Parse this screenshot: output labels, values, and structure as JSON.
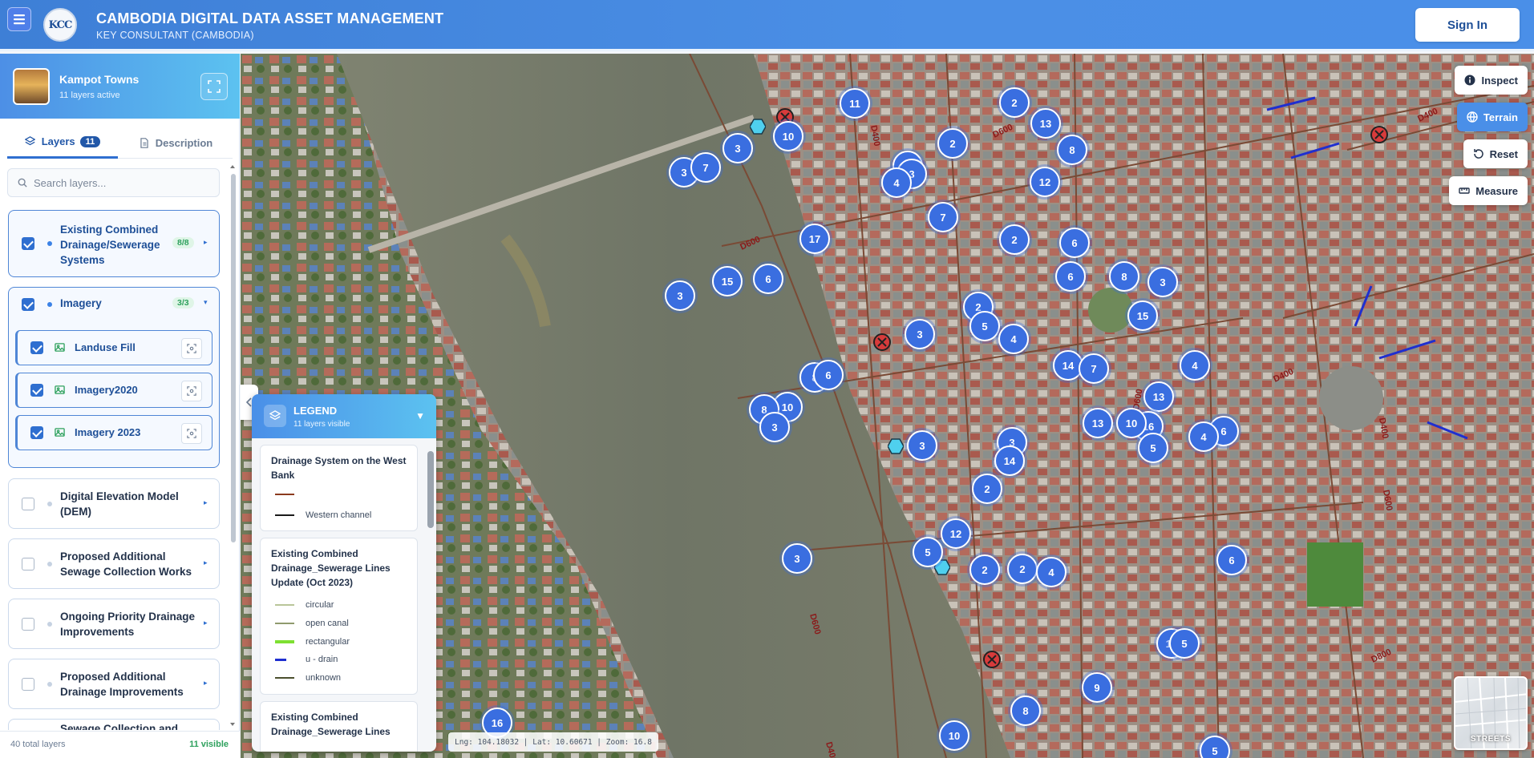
{
  "header": {
    "title": "CAMBODIA DIGITAL DATA ASSET MANAGEMENT",
    "subtitle": "KEY CONSULTANT (CAMBODIA)",
    "logo_text": "KCC",
    "sign_in_label": "Sign In"
  },
  "project": {
    "name": "Kampot Towns",
    "status": "11 layers active"
  },
  "tabs": {
    "layers_label": "Layers",
    "layers_count": "11",
    "description_label": "Description"
  },
  "search": {
    "placeholder": "Search layers..."
  },
  "layer_groups": [
    {
      "label": "Existing Combined Drainage/Sewerage Systems",
      "badge": "8/8",
      "checked": true
    },
    {
      "label": "Imagery",
      "badge": "3/3",
      "checked": true,
      "children": [
        {
          "label": "Landuse Fill",
          "checked": true
        },
        {
          "label": "Imagery2020",
          "checked": true
        },
        {
          "label": "Imagery 2023",
          "checked": true
        }
      ]
    },
    {
      "label": "Digital Elevation Model (DEM)",
      "checked": false
    },
    {
      "label": "Proposed Additional Sewage Collection Works",
      "checked": false
    },
    {
      "label": "Ongoing Priority Drainage Improvements",
      "checked": false
    },
    {
      "label": "Proposed Additional Drainage Improvements",
      "checked": false
    },
    {
      "label": "Sewage Collection and",
      "checked": false
    }
  ],
  "footer": {
    "total": "40 total layers",
    "visible": "11 visible"
  },
  "map_tools": {
    "inspect": "Inspect",
    "terrain": "Terrain",
    "reset": "Reset",
    "measure": "Measure"
  },
  "basemap_label": "STREETS",
  "coords_text": "Lng: 104.18032 | Lat: 10.60671 | Zoom: 16.8",
  "legend": {
    "title": "LEGEND",
    "subtitle": "11 layers visible",
    "sections": [
      {
        "title": "Drainage System on the West Bank",
        "items": [
          {
            "label": "",
            "color": "#8b3a1e"
          },
          {
            "label": "Western channel",
            "color": "#1a1a1a"
          }
        ]
      },
      {
        "title": "Existing Combined Drainage_Sewerage Lines Update (Oct 2023)",
        "items": [
          {
            "label": "circular",
            "color": "#b9c59a"
          },
          {
            "label": "open canal",
            "color": "#8f9a6d"
          },
          {
            "label": "rectangular",
            "color": "#7ee032"
          },
          {
            "label": "u - drain",
            "color": "#1f2fd0"
          },
          {
            "label": "unknown",
            "color": "#4b4f2e"
          }
        ]
      },
      {
        "title": "Existing Combined Drainage_Sewerage Lines"
      }
    ]
  },
  "map_labels": [
    "D600",
    "D400",
    "D600",
    "D400",
    "D600",
    "D400",
    "D600",
    "D800",
    "D600",
    "D400",
    "D400"
  ],
  "clusters": [
    "3",
    "7",
    "3",
    "10",
    "11",
    "2",
    "2",
    "8",
    "3",
    "13",
    "8",
    "4",
    "12",
    "7",
    "2",
    "6",
    "17",
    "15",
    "6",
    "3",
    "6",
    "8",
    "2",
    "15",
    "5",
    "3",
    "3",
    "4",
    "14",
    "7",
    "8",
    "10",
    "6",
    "8",
    "4",
    "13",
    "16",
    "10",
    "13",
    "6",
    "3",
    "3",
    "3",
    "2",
    "4",
    "5",
    "14",
    "12",
    "5",
    "3",
    "2",
    "4",
    "2",
    "6",
    "10",
    "5",
    "9",
    "8",
    "10",
    "16",
    "5"
  ],
  "colors": {
    "accent": "#3a6ee0",
    "header": "#4a8fe8",
    "success": "#2ea15d"
  }
}
